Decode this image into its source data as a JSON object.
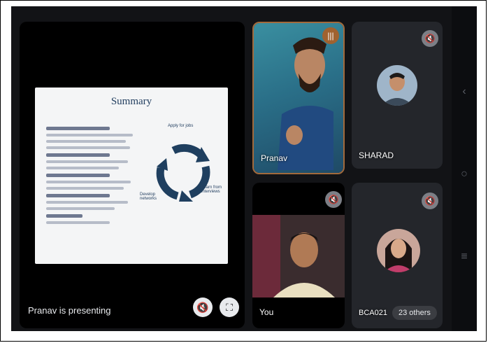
{
  "presentation": {
    "label": "Pranav is presenting",
    "slide_title": "Summary",
    "cycle_labels": [
      "Apply for jobs",
      "Learn from interviews",
      "Develop networks"
    ]
  },
  "participants": [
    {
      "name": "Pranav",
      "speaking": true
    },
    {
      "name": "SHARAD",
      "muted": true
    },
    {
      "name": "You",
      "muted": true
    },
    {
      "name": "BCA021",
      "muted": true
    }
  ],
  "others_chip": "23 others",
  "icons": {
    "presenting_muted": "mic-off-icon",
    "fullscreen": "fullscreen-icon",
    "speaking": "audio-wave-icon",
    "muted": "mic-off-icon",
    "nav": [
      "back-icon",
      "home-icon",
      "menu-icon"
    ]
  },
  "colors": {
    "background": "#121316",
    "tile": "#24262b",
    "active_speaker": "#a26a3c"
  }
}
